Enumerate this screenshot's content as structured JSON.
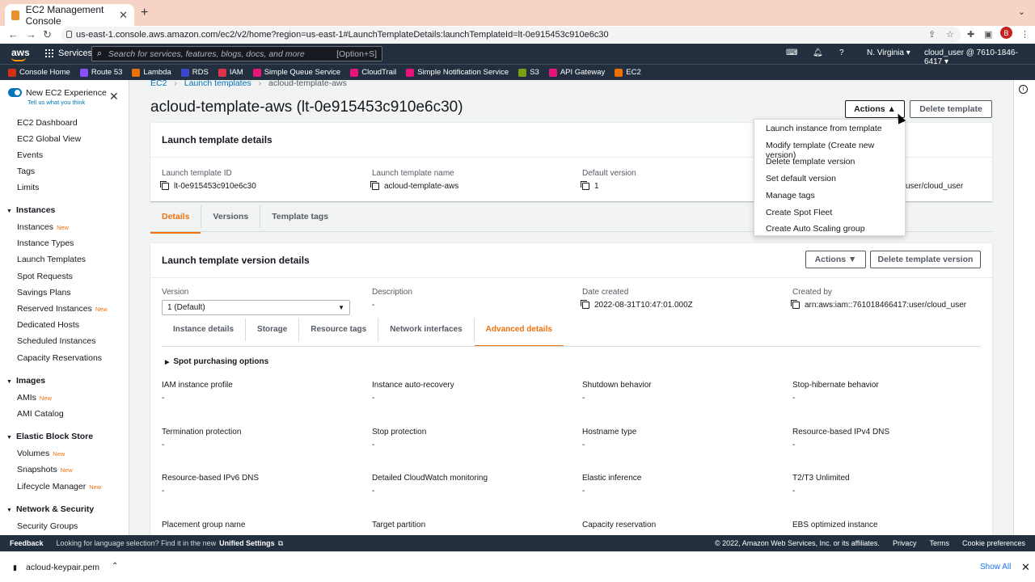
{
  "browser": {
    "tab_title": "EC2 Management Console",
    "url": "us-east-1.console.aws.amazon.com/ec2/v2/home?region=us-east-1#LaunchTemplateDetails:launchTemplateId=lt-0e915453c910e6c30",
    "avatar_letter": "B"
  },
  "aws_nav": {
    "services": "Services",
    "search_placeholder": "Search for services, features, blogs, docs, and more",
    "search_shortcut": "[Option+S]",
    "region": "N. Virginia",
    "account": "cloud_user @ 7610-1846-6417"
  },
  "favorites": [
    {
      "label": "Console Home",
      "color": "#d13212"
    },
    {
      "label": "Route 53",
      "color": "#8c4fff"
    },
    {
      "label": "Lambda",
      "color": "#ed7100"
    },
    {
      "label": "RDS",
      "color": "#3b48cc"
    },
    {
      "label": "IAM",
      "color": "#dd344c"
    },
    {
      "label": "Simple Queue Service",
      "color": "#e7157b"
    },
    {
      "label": "CloudTrail",
      "color": "#e7157b"
    },
    {
      "label": "Simple Notification Service",
      "color": "#e7157b"
    },
    {
      "label": "S3",
      "color": "#7aa116"
    },
    {
      "label": "API Gateway",
      "color": "#e7157b"
    },
    {
      "label": "EC2",
      "color": "#ed7100"
    }
  ],
  "sidebar": {
    "new_exp": "New EC2 Experience",
    "new_exp_sub": "Tell us what you think",
    "new_badge": "New",
    "items": [
      {
        "label": "EC2 Dashboard"
      },
      {
        "label": "EC2 Global View"
      },
      {
        "label": "Events"
      },
      {
        "label": "Tags"
      },
      {
        "label": "Limits"
      }
    ],
    "sections": [
      {
        "title": "Instances",
        "items": [
          "Instances",
          "Instance Types",
          "Launch Templates",
          "Spot Requests",
          "Savings Plans",
          "Reserved Instances",
          "Dedicated Hosts",
          "Scheduled Instances",
          "Capacity Reservations"
        ]
      },
      {
        "title": "Images",
        "items": [
          "AMIs",
          "AMI Catalog"
        ]
      },
      {
        "title": "Elastic Block Store",
        "items": [
          "Volumes",
          "Snapshots",
          "Lifecycle Manager"
        ]
      },
      {
        "title": "Network & Security",
        "items": [
          "Security Groups"
        ]
      }
    ]
  },
  "breadcrumb": [
    "EC2",
    "Launch templates",
    "acloud-template-aws"
  ],
  "page_title": "acloud-template-aws (lt-0e915453c910e6c30)",
  "header_buttons": {
    "actions": "Actions",
    "delete": "Delete template"
  },
  "actions_menu": [
    "Launch instance from template",
    "Modify template (Create new version)",
    "Delete template version",
    "Set default version",
    "Manage tags",
    "Create Spot Fleet",
    "Create Auto Scaling group"
  ],
  "details": {
    "title": "Launch template details",
    "id_label": "Launch template ID",
    "id_value": "lt-0e915453c910e6c30",
    "name_label": "Launch template name",
    "name_value": "acloud-template-aws",
    "default_label": "Default version",
    "default_value": "1",
    "owner_value_partial": "user/cloud_user"
  },
  "main_tabs": [
    "Details",
    "Versions",
    "Template tags"
  ],
  "version_details": {
    "title": "Launch template version details",
    "actions": "Actions",
    "delete": "Delete template version",
    "version_label": "Version",
    "version_value": "1 (Default)",
    "desc_label": "Description",
    "desc_value": "-",
    "date_label": "Date created",
    "date_value": "2022-08-31T10:47:01.000Z",
    "created_by_label": "Created by",
    "created_by_value": "arn:aws:iam::761018466417:user/cloud_user"
  },
  "sub_tabs": [
    "Instance details",
    "Storage",
    "Resource tags",
    "Network interfaces",
    "Advanced details"
  ],
  "spot_options": "Spot purchasing options",
  "advanced_fields": [
    {
      "label": "IAM instance profile",
      "value": "-"
    },
    {
      "label": "Instance auto-recovery",
      "value": "-"
    },
    {
      "label": "Shutdown behavior",
      "value": "-"
    },
    {
      "label": "Stop-hibernate behavior",
      "value": "-"
    },
    {
      "label": "Termination protection",
      "value": "-"
    },
    {
      "label": "Stop protection",
      "value": "-"
    },
    {
      "label": "Hostname type",
      "value": "-"
    },
    {
      "label": "Resource-based IPv4 DNS",
      "value": "-"
    },
    {
      "label": "Resource-based IPv6 DNS",
      "value": "-"
    },
    {
      "label": "Detailed CloudWatch monitoring",
      "value": "-"
    },
    {
      "label": "Elastic inference",
      "value": "-"
    },
    {
      "label": "T2/T3 Unlimited",
      "value": "-"
    },
    {
      "label": "Placement group name",
      "value": ""
    },
    {
      "label": "Target partition",
      "value": ""
    },
    {
      "label": "Capacity reservation",
      "value": ""
    },
    {
      "label": "EBS optimized instance",
      "value": ""
    }
  ],
  "footer": {
    "feedback": "Feedback",
    "lang_msg": "Looking for language selection? Find it in the new",
    "unified": "Unified Settings",
    "copyright": "© 2022, Amazon Web Services, Inc. or its affiliates.",
    "privacy": "Privacy",
    "terms": "Terms",
    "cookies": "Cookie preferences"
  },
  "download": {
    "file": "acloud-keypair.pem",
    "show_all": "Show All"
  }
}
